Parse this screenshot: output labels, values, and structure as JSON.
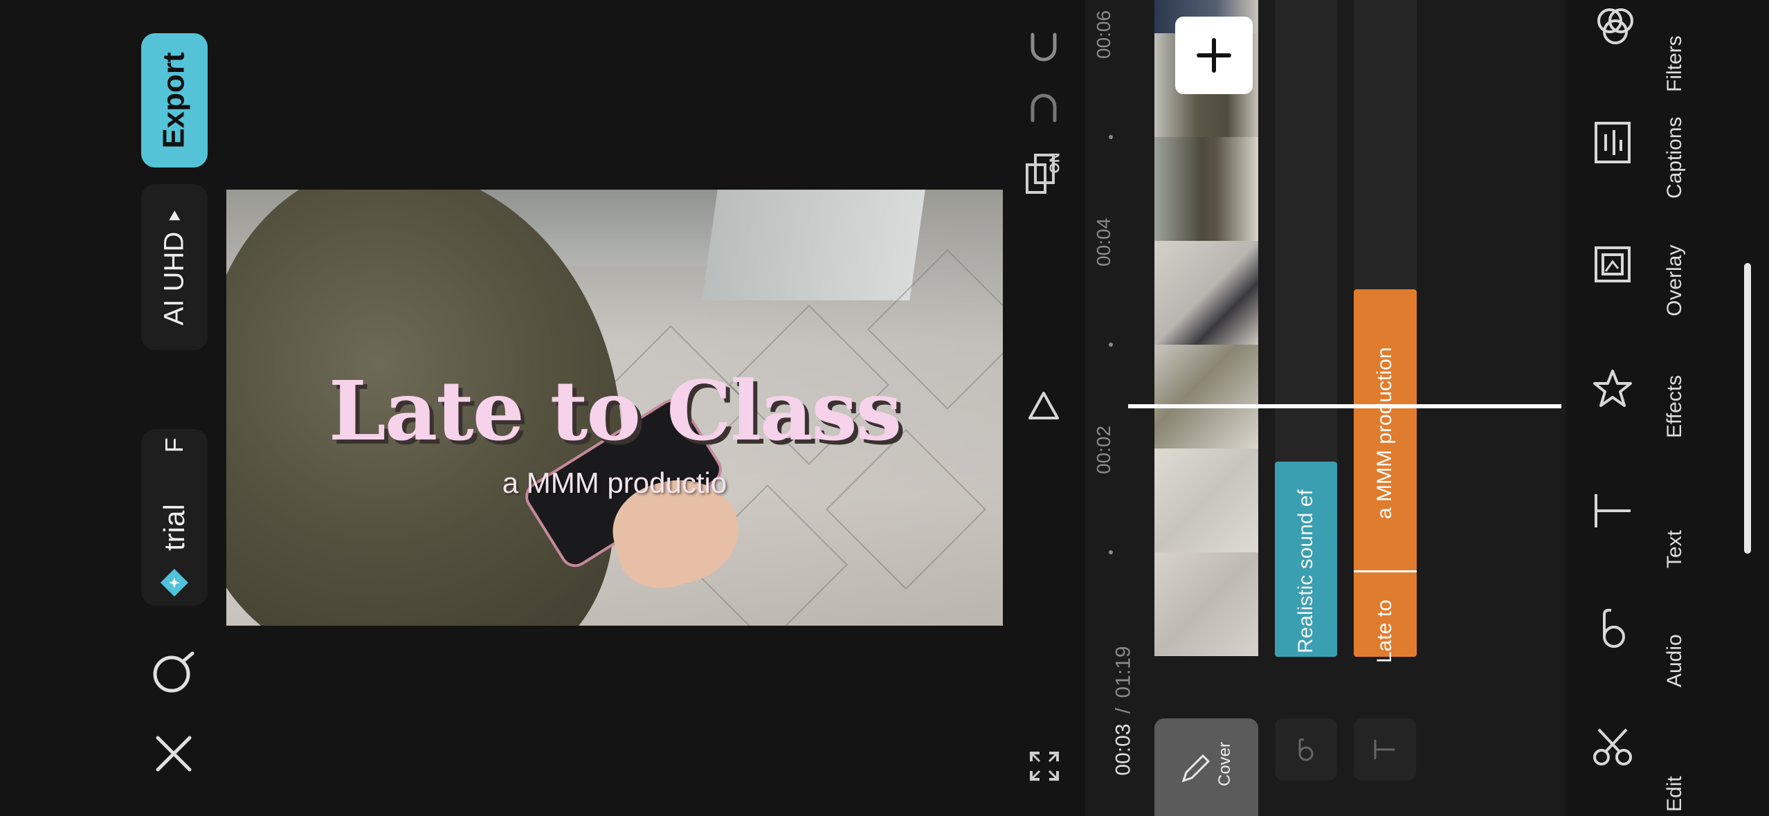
{
  "left": {
    "export_label": "Export",
    "quality_label": "AI UHD",
    "trial_label": "trial",
    "trial_extra": "F"
  },
  "preview": {
    "title": "Late to Class",
    "subtitle": "a MMM productio"
  },
  "controls": {
    "keyframe_on": "ON"
  },
  "timeline": {
    "current_time": "00:03",
    "total_time": "01:19",
    "separator": "/",
    "ticks": [
      "00:06",
      "00:04",
      "00:02"
    ],
    "sound_clip_label": "Realistic sound ef",
    "text_clip_a_label": "a MMM production",
    "text_clip_b_label": "Late to",
    "cover_label": "Cover"
  },
  "tools": [
    {
      "label": "Filters",
      "icon": "filters-icon"
    },
    {
      "label": "Captions",
      "icon": "captions-icon"
    },
    {
      "label": "Overlay",
      "icon": "overlay-icon"
    },
    {
      "label": "Effects",
      "icon": "effects-icon"
    },
    {
      "label": "Text",
      "icon": "text-icon"
    },
    {
      "label": "Audio",
      "icon": "audio-icon"
    },
    {
      "label": "Edit",
      "icon": "scissors-icon"
    }
  ],
  "colors": {
    "accent": "#55c3d7",
    "sound_clip": "#3a9fb0",
    "text_clip": "#e07c2e",
    "title_text": "#f6d3ea"
  }
}
